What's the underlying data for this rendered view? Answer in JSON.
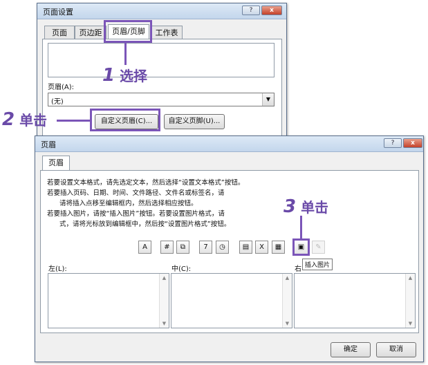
{
  "page_setup": {
    "title": "页面设置",
    "help_label": "?",
    "close_label": "x",
    "tabs": [
      {
        "label": "页面"
      },
      {
        "label": "页边距"
      },
      {
        "label": "页眉/页脚"
      },
      {
        "label": "工作表"
      }
    ],
    "header_label": "页眉(A):",
    "header_value": "(无)",
    "custom_header_button": "自定义页眉(C)...",
    "custom_footer_button": "自定义页脚(U)..."
  },
  "header_dialog": {
    "title": "页眉",
    "help_label": "?",
    "close_label": "x",
    "tab": "页眉",
    "instructions": [
      "若要设置文本格式，请先选定文本，然后选择“设置文本格式”按钮。",
      "若要插入页码、日期、时间、文件路径、文件名或标签名，请",
      "请将插入点移至编辑框内，然后选择相应按钮。",
      "若要插入图片，请按“插入图片”按钮。若要设置图片格式，请",
      "式，请将光标放到编辑框中，然后按“设置图片格式”按钮。"
    ],
    "toolbar": [
      {
        "icon": "format-text-icon",
        "glyph": "A"
      },
      {
        "icon": "page-number-icon",
        "glyph": "#"
      },
      {
        "icon": "number-of-pages-icon",
        "glyph": "⧉"
      },
      {
        "icon": "date-icon",
        "glyph": "7"
      },
      {
        "icon": "time-icon",
        "glyph": "◷"
      },
      {
        "icon": "file-path-icon",
        "glyph": "▤"
      },
      {
        "icon": "file-name-icon",
        "glyph": "X"
      },
      {
        "icon": "sheet-name-icon",
        "glyph": "▦"
      },
      {
        "icon": "insert-picture-icon",
        "glyph": "▣"
      },
      {
        "icon": "format-picture-icon",
        "glyph": "✎"
      }
    ],
    "tooltip": "插入图片",
    "left_label": "左(L):",
    "center_label": "中(C):",
    "right_label": "右",
    "ok_button": "确定",
    "cancel_button": "取消"
  },
  "callouts": {
    "step1_num": "1",
    "step1_text": "选择",
    "step2_num": "2",
    "step2_text": "单击",
    "step3_num": "3",
    "step3_text": "单击"
  },
  "colors": {
    "accent": "#7b55b8"
  }
}
